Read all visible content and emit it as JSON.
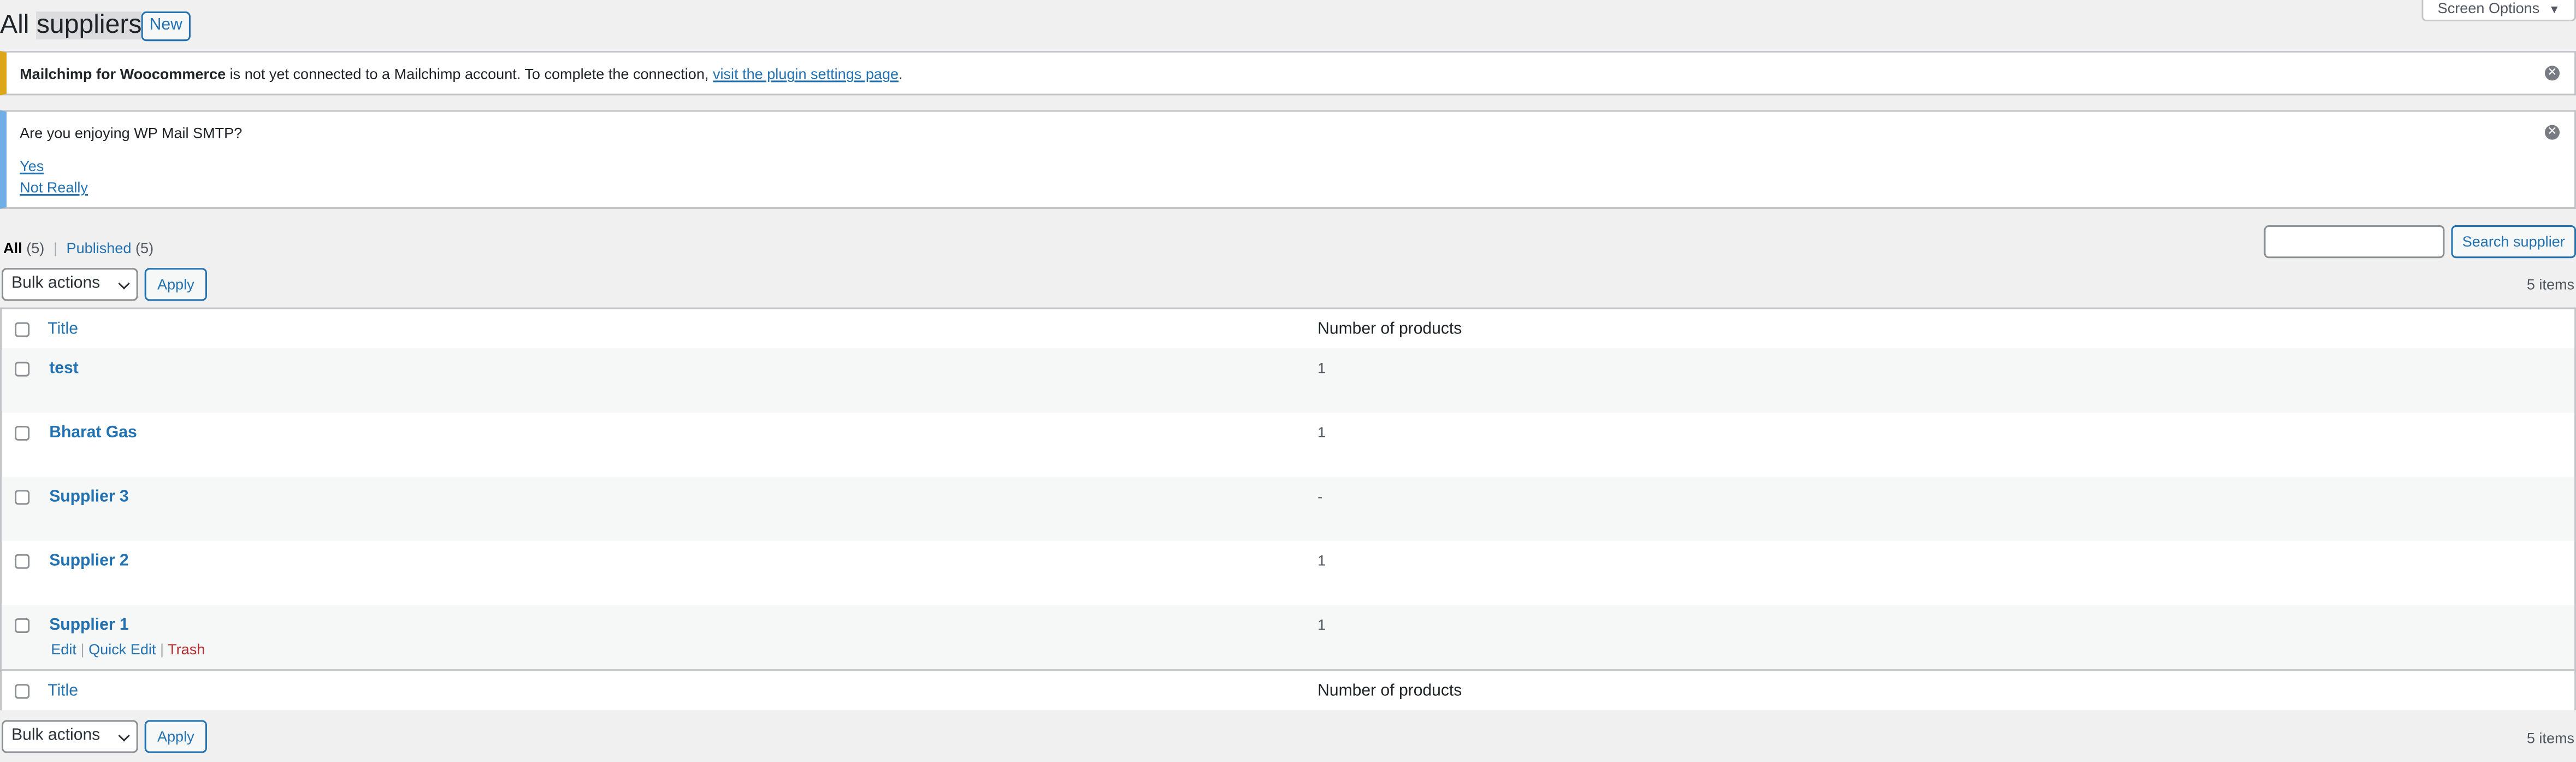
{
  "header": {
    "title_prefix": "All ",
    "title_highlight": "suppliers",
    "new_button": "New",
    "screen_options": "Screen Options"
  },
  "notices": {
    "mailchimp": {
      "strong": "Mailchimp for Woocommerce",
      "text": " is not yet connected to a Mailchimp account. To complete the connection, ",
      "link": "visit the plugin settings page",
      "end": ".",
      "accent": "#dba617"
    },
    "smtp": {
      "question": "Are you enjoying WP Mail SMTP?",
      "yes": "Yes",
      "no": "Not Really",
      "accent": "#72aee6"
    }
  },
  "filters": {
    "all_label": "All",
    "all_count": "(5)",
    "separator": "|",
    "published_label": "Published",
    "published_count": "(5)"
  },
  "search": {
    "value": "",
    "button": "Search supplier"
  },
  "bulk": {
    "top_select": "Bulk actions",
    "top_apply": "Apply",
    "bottom_select": "Bulk actions",
    "bottom_apply": "Apply",
    "items_count": "5 items"
  },
  "table": {
    "columns": [
      "Title",
      "Number of products"
    ],
    "rows": [
      {
        "title": "test",
        "products": "1"
      },
      {
        "title": "Bharat Gas",
        "products": "1"
      },
      {
        "title": "Supplier 3",
        "products": "-"
      },
      {
        "title": "Supplier 2",
        "products": "1"
      },
      {
        "title": "Supplier 1",
        "products": "1"
      }
    ],
    "row_actions": {
      "edit": "Edit",
      "quick_edit": "Quick Edit",
      "trash": "Trash",
      "sep": "|"
    }
  },
  "colors": {
    "link": "#2271b1",
    "trash": "#b32d2e",
    "background": "#f0f0f1"
  },
  "icons": {
    "dismiss": "close-circle-icon",
    "dropdown": "chevron-down-icon",
    "screen_options_arrow": "triangle-down-icon"
  }
}
